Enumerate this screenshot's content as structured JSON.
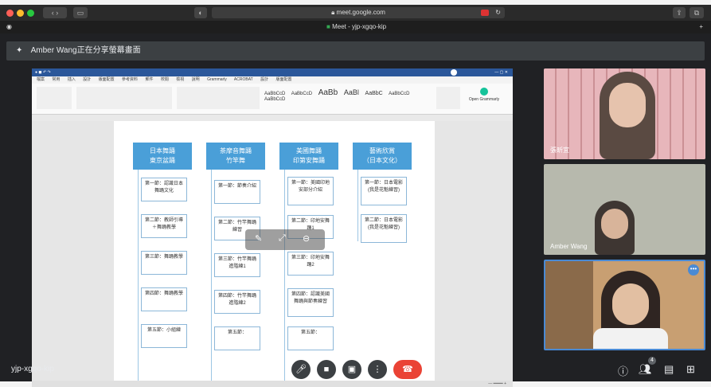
{
  "browser": {
    "url": "meet.google.com",
    "tab_title": "Meet - yjp-xgqo-kip"
  },
  "meet": {
    "banner_text": "Amber Wang正在分享螢幕畫面",
    "meeting_code": "yjp-xgqo-kip",
    "participant_count": "4",
    "participants": [
      {
        "name": "張昕宜"
      },
      {
        "name": "Amber Wang"
      },
      {
        "name": ""
      }
    ]
  },
  "word": {
    "ribbon_tabs": [
      "檔案",
      "常用",
      "插入",
      "設計",
      "版面配置",
      "參考資料",
      "郵件",
      "校閱",
      "檢視",
      "說明",
      "Grammarly",
      "ACROBAT",
      "設計",
      "版面配置"
    ],
    "style_samples": [
      "AaBbCcD",
      "AaBbCcD",
      "AaBb",
      "AaBl",
      "AaBbC",
      "AaBbCcD",
      "AaBbCcD"
    ],
    "grammarly_label": "Open Grammarly"
  },
  "diagram": {
    "columns": [
      {
        "header": "日本舞踊\n東京盆踊",
        "items": [
          "第一節：認識日本舞踊文化",
          "第二節：教師引導＋舞踊教學",
          "第三節：舞踊教學",
          "第四節：舞踊教學",
          "第五節：小組練"
        ]
      },
      {
        "header": "茶摩音舞踊\n竹竿舞",
        "items": [
          "第一節：節奏介紹",
          "第二節：竹竿舞踊練習",
          "第三節：竹竿舞踊進階練1",
          "第四節：竹竿舞踊進階練2",
          "第五節："
        ]
      },
      {
        "header": "美國舞踊\n印第安舞踊",
        "items": [
          "第一節：美國印地安部分介紹",
          "第二節：印地安舞踊1",
          "第三節：印地安舞踊2",
          "第四節：認識美國舞踊與節奏練習",
          "第五節："
        ]
      },
      {
        "header": "藝術欣賞\n（日本文化）",
        "items": [
          "第一節：日本電影(我是花魁練習)",
          "第二節：日本電影(我是花魁練習)"
        ]
      }
    ]
  }
}
